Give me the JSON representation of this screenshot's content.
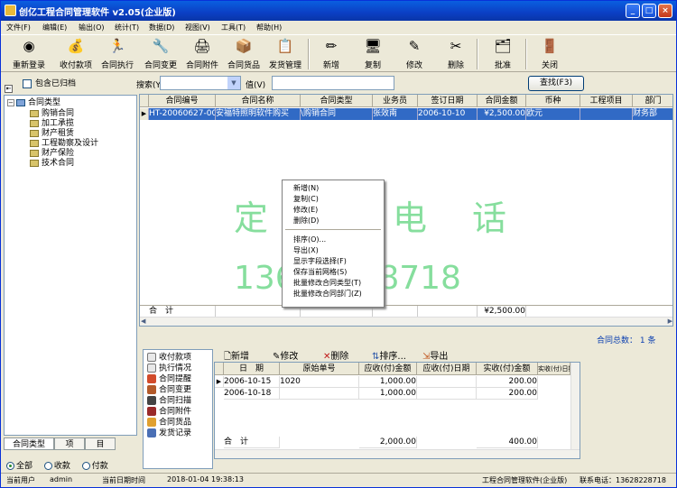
{
  "window": {
    "title": "创亿工程合同管理软件 v2.05(企业版)",
    "controls": [
      "_",
      "□",
      "×"
    ]
  },
  "menu": [
    "文件(F)",
    "编辑(E)",
    "输出(O)",
    "统计(T)",
    "数据(D)",
    "视图(V)",
    "工具(T)",
    "帮助(H)"
  ],
  "toolbar": {
    "relogin": "重新登录",
    "receive_pay": "收付款项",
    "execute": "合同执行",
    "change": "合同变更",
    "attach": "合同附件",
    "goods": "合同货品",
    "ship": "发货管理",
    "add": "新增",
    "copy": "复制",
    "edit": "修改",
    "delete": "删除",
    "approve": "批准",
    "close": "关闭"
  },
  "left": {
    "include_archived": "包含已归档",
    "tree_root": "合同类型",
    "tree_items": [
      "购销合同",
      "加工承揽",
      "财产租赁",
      "工程勘察及设计",
      "财产保险",
      "技术合同"
    ],
    "tabs": [
      "合同类型",
      "项",
      "目"
    ],
    "radios": [
      "全部",
      "收款",
      "付款"
    ]
  },
  "search": {
    "label": "搜索(Y)",
    "value_label": "值(V)",
    "button": "查找(F3)"
  },
  "grid": {
    "columns": [
      "合同编号",
      "合同名称",
      "合同类型",
      "业务员",
      "签订日期",
      "合同金额",
      "币种",
      "工程项目",
      "部门"
    ],
    "row": [
      "HT-20060627-00",
      "安福特照明软件购买",
      "\\购销合同",
      "张效南",
      "2006-10-10",
      "¥2,500.00",
      "欧元",
      "",
      "财务部"
    ],
    "footer_label": "合　计",
    "footer_amount": "¥2,500.00",
    "total_info": "合同总数： 1 条"
  },
  "watermark": {
    "line1": "定　购　电　话",
    "line2": "13628228718"
  },
  "context_menu": [
    "新增(N)",
    "复制(C)",
    "修改(E)",
    "删除(D)",
    "排序(O)...",
    "导出(X)",
    "显示字段选择(F)",
    "保存当前网格(S)",
    "批量修改合同类型(T)",
    "批量修改合同部门(Z)"
  ],
  "side_list": [
    "收付款项",
    "执行情况",
    "合同提醒",
    "合同变更",
    "合同扫描",
    "合同附件",
    "合同货品",
    "发货记录"
  ],
  "sub_toolbar": {
    "add": "新增",
    "edit": "修改",
    "delete": "删除",
    "sort": "排序...",
    "export": "导出"
  },
  "sub_grid": {
    "columns": [
      "日　期",
      "原始单号",
      "应收(付)金额",
      "应收(付)日期",
      "实收(付)金额",
      "实收(付)日期"
    ],
    "rows": [
      [
        "2006-10-15",
        "1020",
        "1,000.00",
        "",
        "200.00"
      ],
      [
        "2006-10-18",
        "",
        "1,000.00",
        "",
        "200.00"
      ]
    ],
    "footer_label": "合　计",
    "footer_due": "2,000.00",
    "footer_paid": "400.00"
  },
  "status": {
    "user_label": "当前用户",
    "user": "admin",
    "date_label": "当前日期时间",
    "datetime": "2018-01-04 19:38:13",
    "product": "工程合同管理软件(企业版)",
    "contact": "联系电话：13628228718"
  }
}
